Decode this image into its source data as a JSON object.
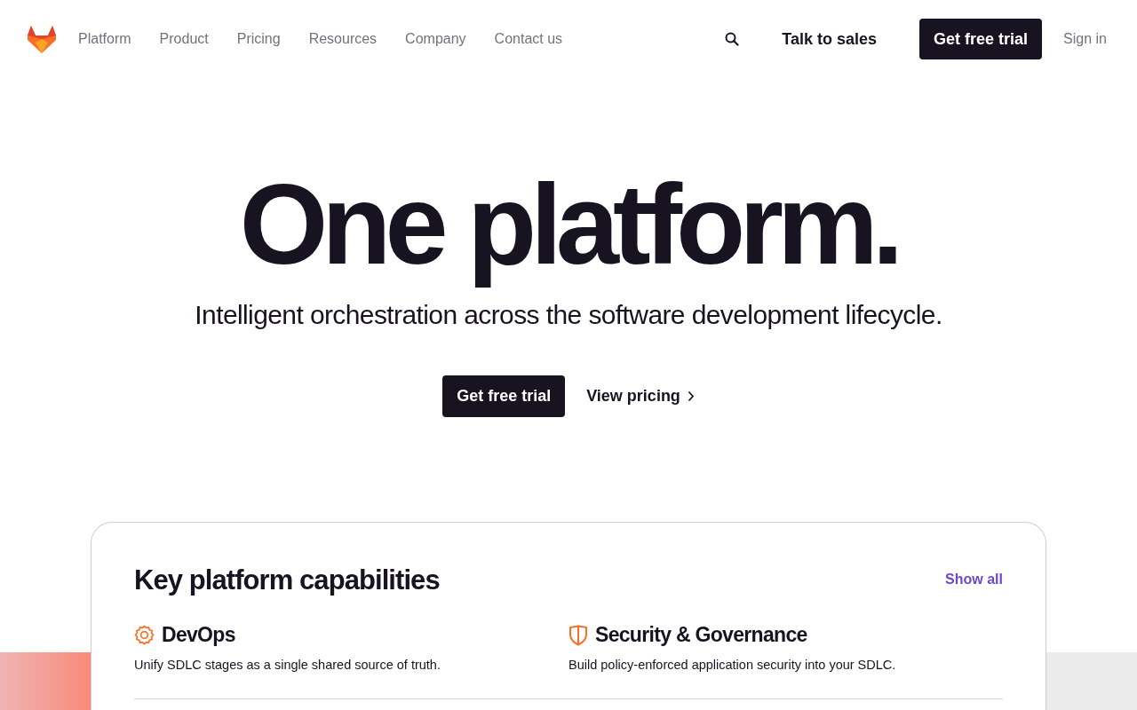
{
  "nav": {
    "links": [
      "Platform",
      "Product",
      "Pricing",
      "Resources",
      "Company",
      "Contact us"
    ],
    "sales": "Talk to sales",
    "trial": "Get free trial",
    "sign_in": "Sign in"
  },
  "hero": {
    "title": "One platform.",
    "subtitle": "Intelligent orchestration across the software development lifecycle.",
    "primary": "Get free trial",
    "secondary": "View pricing"
  },
  "capabilities": {
    "title": "Key platform capabilities",
    "show_all": "Show all",
    "items": [
      {
        "kind": "gear",
        "title": "DevOps",
        "description": "Unify SDLC stages as a single shared source of truth."
      },
      {
        "kind": "shield",
        "title": "Security & Governance",
        "description": "Build policy-enforced application security into your SDLC."
      }
    ]
  }
}
